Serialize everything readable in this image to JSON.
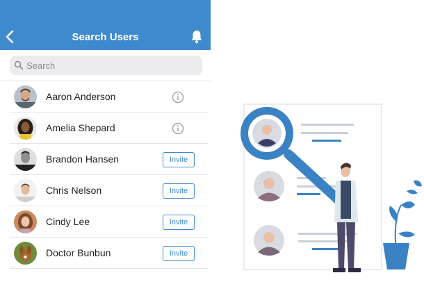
{
  "header": {
    "title": "Search Users",
    "background_color": "#3f89cf"
  },
  "search": {
    "placeholder": "Search"
  },
  "users": [
    {
      "name": "Aaron Anderson",
      "action": "info"
    },
    {
      "name": "Amelia Shepard",
      "action": "info"
    },
    {
      "name": "Brandon Hansen",
      "action": "invite",
      "action_label": "Invite"
    },
    {
      "name": "Chris Nelson",
      "action": "invite",
      "action_label": "Invite"
    },
    {
      "name": "Cindy Lee",
      "action": "invite",
      "action_label": "Invite"
    },
    {
      "name": "Doctor Bunbun",
      "action": "invite",
      "action_label": "Invite"
    }
  ],
  "icons": {
    "back": "chevron-left-icon",
    "notifications": "bell-icon",
    "search": "search-icon",
    "info": "info-icon"
  },
  "colors": {
    "accent": "#3f89cf",
    "illustration_blue": "#3b82c4"
  }
}
